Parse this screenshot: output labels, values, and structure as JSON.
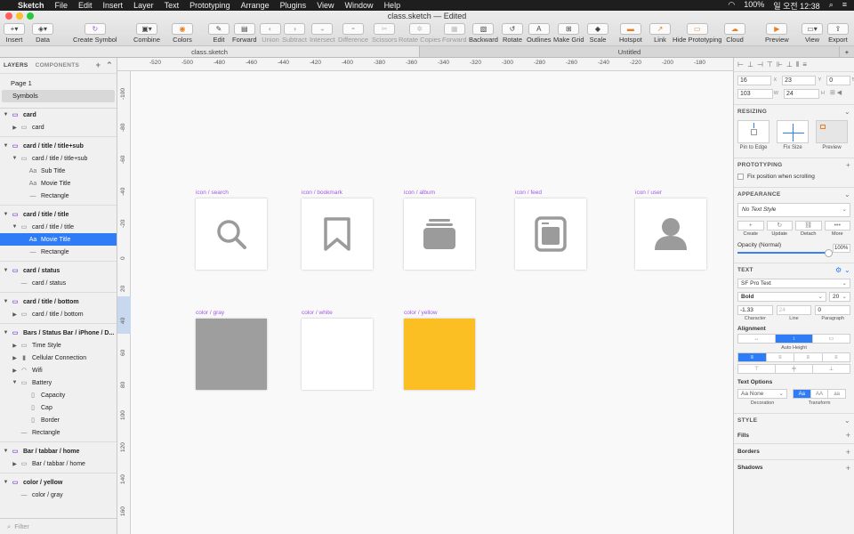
{
  "menubar": {
    "items": [
      "Sketch",
      "File",
      "Edit",
      "Insert",
      "Layer",
      "Text",
      "Prototyping",
      "Arrange",
      "Plugins",
      "View",
      "Window",
      "Help"
    ],
    "battery": "100%",
    "clock": "일 오전 12:38"
  },
  "window": {
    "title": "class.sketch — Edited"
  },
  "toolbar": {
    "insert": "Insert",
    "data": "Data",
    "create_symbol": "Create Symbol",
    "combine": "Combine",
    "colors": "Colors",
    "edit": "Edit",
    "forward_main": "Forward",
    "union": "Union",
    "subtract": "Subtract",
    "intersect": "Intersect",
    "difference": "Difference",
    "scissors": "Scissors",
    "rotate_copies": "Rotate Copies",
    "forward": "Forward",
    "backward": "Backward",
    "rotate": "Rotate",
    "outlines": "Outlines",
    "make_grid": "Make Grid",
    "scale": "Scale",
    "hotspot": "Hotspot",
    "link": "Link",
    "hide_prototyping": "Hide Prototyping",
    "cloud": "Cloud",
    "preview": "Preview",
    "view": "View",
    "export": "Export"
  },
  "tabs": {
    "left": "class.sketch",
    "right": "Untitled"
  },
  "sidebar": {
    "layers_tab": "LAYERS",
    "components_tab": "COMPONENTS",
    "pages": [
      "Page 1",
      "Symbols"
    ],
    "filter": "Filter",
    "layers": [
      {
        "label": "card",
        "depth": 0,
        "kind": "art",
        "tri": "▼"
      },
      {
        "label": "card",
        "depth": 1,
        "kind": "group",
        "tri": "▶"
      },
      {
        "label": "card / title / title+sub",
        "depth": 0,
        "kind": "art",
        "tri": "▼"
      },
      {
        "label": "card / title / title+sub",
        "depth": 1,
        "kind": "group",
        "tri": "▼"
      },
      {
        "label": "Sub Title",
        "depth": 2,
        "kind": "text",
        "tri": ""
      },
      {
        "label": "Movie Title",
        "depth": 2,
        "kind": "text",
        "tri": ""
      },
      {
        "label": "Rectangle",
        "depth": 2,
        "kind": "rect",
        "tri": ""
      },
      {
        "label": "card / title / title",
        "depth": 0,
        "kind": "art",
        "tri": "▼"
      },
      {
        "label": "card / title / title",
        "depth": 1,
        "kind": "group",
        "tri": "▼"
      },
      {
        "label": "Movie Title",
        "depth": 2,
        "kind": "text",
        "tri": "",
        "selected": true
      },
      {
        "label": "Rectangle",
        "depth": 2,
        "kind": "rect",
        "tri": ""
      },
      {
        "label": "card / status",
        "depth": 0,
        "kind": "art",
        "tri": "▼"
      },
      {
        "label": "card / status",
        "depth": 1,
        "kind": "rect",
        "tri": ""
      },
      {
        "label": "card / title / bottom",
        "depth": 0,
        "kind": "art",
        "tri": "▼"
      },
      {
        "label": "card / title / bottom",
        "depth": 1,
        "kind": "group",
        "tri": "▶"
      },
      {
        "label": "Bars / Status Bar / iPhone / D...",
        "depth": 0,
        "kind": "art",
        "tri": "▼"
      },
      {
        "label": "Time Style",
        "depth": 1,
        "kind": "group",
        "tri": "▶"
      },
      {
        "label": "Cellular Connection",
        "depth": 1,
        "kind": "signal",
        "tri": "▶"
      },
      {
        "label": "Wifi",
        "depth": 1,
        "kind": "wifi",
        "tri": "▶"
      },
      {
        "label": "Battery",
        "depth": 1,
        "kind": "group",
        "tri": "▼"
      },
      {
        "label": "Capacity",
        "depth": 2,
        "kind": "shape",
        "tri": ""
      },
      {
        "label": "Cap",
        "depth": 2,
        "kind": "shape",
        "tri": ""
      },
      {
        "label": "Border",
        "depth": 2,
        "kind": "shape",
        "tri": ""
      },
      {
        "label": "Rectangle",
        "depth": 1,
        "kind": "rect",
        "tri": ""
      },
      {
        "label": "Bar / tabbar / home",
        "depth": 0,
        "kind": "art",
        "tri": "▼"
      },
      {
        "label": "Bar / tabbar / home",
        "depth": 1,
        "kind": "group",
        "tri": "▶"
      },
      {
        "label": "color / yellow",
        "depth": 0,
        "kind": "art",
        "tri": "▼"
      },
      {
        "label": "color / gray",
        "depth": 1,
        "kind": "rect",
        "tri": ""
      }
    ]
  },
  "rulers": {
    "top": [
      "-520",
      "-500",
      "-480",
      "-460",
      "-440",
      "-420",
      "-400",
      "-380",
      "-360",
      "-340",
      "-320",
      "-300",
      "-280",
      "-260",
      "-240",
      "-220",
      "-200",
      "-180"
    ],
    "left": [
      "-100",
      "-80",
      "-60",
      "-40",
      "-20",
      "0",
      "20",
      "40",
      "60",
      "80",
      "100",
      "120",
      "140",
      "160"
    ]
  },
  "canvas": {
    "artboards": [
      {
        "label": "icon / search",
        "icon": "search"
      },
      {
        "label": "icon / bookmark",
        "icon": "bookmark"
      },
      {
        "label": "icon / album",
        "icon": "album"
      },
      {
        "label": "icon / feed",
        "icon": "feed"
      },
      {
        "label": "icon / user",
        "icon": "user"
      },
      {
        "label": "color / gray",
        "icon": "gray"
      },
      {
        "label": "color / white",
        "icon": "white"
      },
      {
        "label": "color / yellow",
        "icon": "yellow"
      }
    ],
    "colors": {
      "gray": "#9e9e9e",
      "white": "#ffffff",
      "yellow": "#fbbf24",
      "icon": "#9b9b9b"
    }
  },
  "inspector": {
    "x": "16",
    "y": "23",
    "rotation": "0",
    "w": "103",
    "h": "24",
    "resizing_title": "RESIZING",
    "resize_options": [
      "Pin to Edge",
      "Fix Size",
      "Preview"
    ],
    "prototyping_title": "PROTOTYPING",
    "fix_position": "Fix position when scrolling",
    "appearance_title": "APPEARANCE",
    "text_style": "No Text Style",
    "style_actions": [
      "Create",
      "Update",
      "Detach",
      "More"
    ],
    "opacity_label": "Opacity (Normal)",
    "opacity_value": "100%",
    "text_title": "TEXT",
    "font_family": "SF Pro Text",
    "font_weight": "Bold",
    "font_size": "20",
    "character": "-1.33",
    "line": "24",
    "paragraph": "0",
    "character_lbl": "Character",
    "line_lbl": "Line",
    "paragraph_lbl": "Paragraph",
    "alignment_title": "Alignment",
    "auto_height": "Auto Height",
    "text_options_title": "Text Options",
    "decoration": "Aa None",
    "decoration_lbl": "Decoration",
    "transform_lbl": "Transform",
    "transform_opts": [
      "Aa",
      "AA",
      "aa"
    ],
    "style_title": "STYLE",
    "fills": "Fills",
    "borders": "Borders",
    "shadows": "Shadows"
  }
}
